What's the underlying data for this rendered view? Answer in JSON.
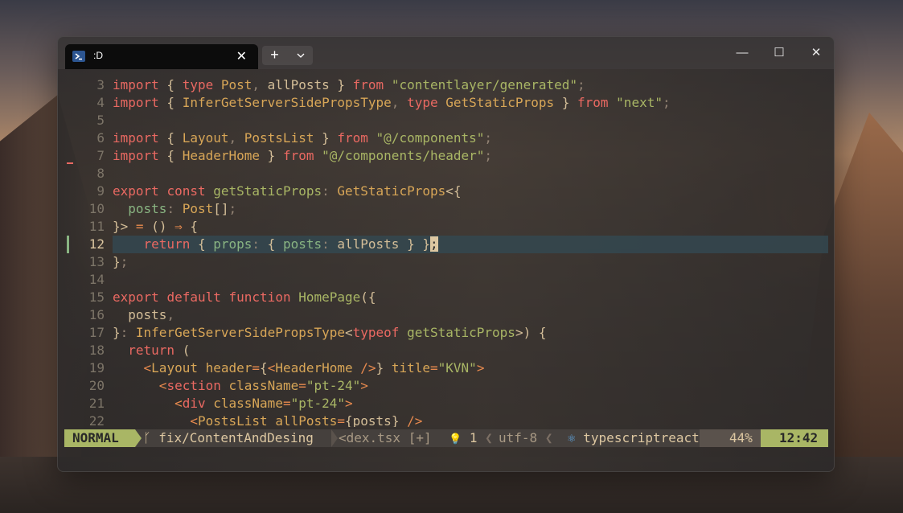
{
  "tab": {
    "title": ":D",
    "close": "✕"
  },
  "titlebar": {
    "new_tab": "+",
    "minimize": "—",
    "maximize": "☐",
    "close": "✕"
  },
  "editor": {
    "lines": [
      {
        "num": "3",
        "tokens": [
          [
            "kw",
            "import"
          ],
          [
            "plain",
            " { "
          ],
          [
            "kw",
            "type"
          ],
          [
            "plain",
            " "
          ],
          [
            "typ",
            "Post"
          ],
          [
            "pun",
            ", "
          ],
          [
            "plain",
            "allPosts } "
          ],
          [
            "kw",
            "from"
          ],
          [
            "plain",
            " "
          ],
          [
            "str",
            "\"contentlayer/generated\""
          ],
          [
            "pun",
            ";"
          ]
        ]
      },
      {
        "num": "4",
        "tokens": [
          [
            "kw",
            "import"
          ],
          [
            "plain",
            " { "
          ],
          [
            "typ",
            "InferGetServerSidePropsType"
          ],
          [
            "pun",
            ", "
          ],
          [
            "kw",
            "type"
          ],
          [
            "plain",
            " "
          ],
          [
            "typ",
            "GetStaticProps"
          ],
          [
            "plain",
            " } "
          ],
          [
            "kw",
            "from"
          ],
          [
            "plain",
            " "
          ],
          [
            "str",
            "\"next\""
          ],
          [
            "pun",
            ";"
          ]
        ]
      },
      {
        "num": "5",
        "tokens": []
      },
      {
        "num": "6",
        "tokens": [
          [
            "kw",
            "import"
          ],
          [
            "plain",
            " { "
          ],
          [
            "typ",
            "Layout"
          ],
          [
            "pun",
            ", "
          ],
          [
            "typ",
            "PostsList"
          ],
          [
            "plain",
            " } "
          ],
          [
            "kw",
            "from"
          ],
          [
            "plain",
            " "
          ],
          [
            "str",
            "\"@/components\""
          ],
          [
            "pun",
            ";"
          ]
        ]
      },
      {
        "num": "7",
        "tokens": [
          [
            "kw",
            "import"
          ],
          [
            "plain",
            " { "
          ],
          [
            "typ",
            "HeaderHome"
          ],
          [
            "plain",
            " } "
          ],
          [
            "kw",
            "from"
          ],
          [
            "plain",
            " "
          ],
          [
            "str",
            "\"@/components/header\""
          ],
          [
            "pun",
            ";"
          ]
        ]
      },
      {
        "num": "8",
        "tokens": []
      },
      {
        "num": "9",
        "tokens": [
          [
            "kw",
            "export"
          ],
          [
            "plain",
            " "
          ],
          [
            "kw",
            "const"
          ],
          [
            "plain",
            " "
          ],
          [
            "fn",
            "getStaticProps"
          ],
          [
            "pun",
            ": "
          ],
          [
            "typ",
            "GetStaticProps"
          ],
          [
            "plain",
            "<{"
          ]
        ]
      },
      {
        "num": "10",
        "tokens": [
          [
            "plain",
            "  "
          ],
          [
            "prop",
            "posts"
          ],
          [
            "pun",
            ": "
          ],
          [
            "typ",
            "Post"
          ],
          [
            "plain",
            "[]"
          ],
          [
            "pun",
            ";"
          ]
        ]
      },
      {
        "num": "11",
        "tokens": [
          [
            "plain",
            "}> "
          ],
          [
            "op",
            "="
          ],
          [
            "plain",
            " () "
          ],
          [
            "op",
            "⇒"
          ],
          [
            "plain",
            " {"
          ]
        ]
      },
      {
        "num": "12",
        "tokens": [
          [
            "plain",
            "    "
          ],
          [
            "kw",
            "return"
          ],
          [
            "plain",
            " { "
          ],
          [
            "prop",
            "props"
          ],
          [
            "pun",
            ": "
          ],
          [
            "plain",
            "{ "
          ],
          [
            "prop",
            "posts"
          ],
          [
            "pun",
            ": "
          ],
          [
            "plain",
            "allPosts } }"
          ],
          [
            "cursor",
            ";"
          ]
        ]
      },
      {
        "num": "13",
        "tokens": [
          [
            "plain",
            "}"
          ],
          [
            "pun",
            ";"
          ]
        ]
      },
      {
        "num": "14",
        "tokens": []
      },
      {
        "num": "15",
        "tokens": [
          [
            "kw",
            "export"
          ],
          [
            "plain",
            " "
          ],
          [
            "kw",
            "default"
          ],
          [
            "plain",
            " "
          ],
          [
            "kw",
            "function"
          ],
          [
            "plain",
            " "
          ],
          [
            "fn",
            "HomePage"
          ],
          [
            "plain",
            "({"
          ]
        ]
      },
      {
        "num": "16",
        "tokens": [
          [
            "plain",
            "  posts"
          ],
          [
            "pun",
            ","
          ]
        ]
      },
      {
        "num": "17",
        "tokens": [
          [
            "plain",
            "}"
          ],
          [
            "pun",
            ": "
          ],
          [
            "typ",
            "InferGetServerSidePropsType"
          ],
          [
            "plain",
            "<"
          ],
          [
            "kw",
            "typeof"
          ],
          [
            "plain",
            " "
          ],
          [
            "fn",
            "getStaticProps"
          ],
          [
            "plain",
            ">) {"
          ]
        ]
      },
      {
        "num": "18",
        "tokens": [
          [
            "plain",
            "  "
          ],
          [
            "kw",
            "return"
          ],
          [
            "plain",
            " ("
          ]
        ]
      },
      {
        "num": "19",
        "tokens": [
          [
            "plain",
            "    "
          ],
          [
            "tag",
            "<"
          ],
          [
            "typ",
            "Layout"
          ],
          [
            "plain",
            " "
          ],
          [
            "attr",
            "header"
          ],
          [
            "op",
            "="
          ],
          [
            "plain",
            "{"
          ],
          [
            "tag",
            "<"
          ],
          [
            "typ",
            "HeaderHome"
          ],
          [
            "plain",
            " "
          ],
          [
            "tag",
            "/>"
          ],
          [
            "plain",
            "} "
          ],
          [
            "attr",
            "title"
          ],
          [
            "op",
            "="
          ],
          [
            "str",
            "\"KVN\""
          ],
          [
            "tag",
            ">"
          ]
        ]
      },
      {
        "num": "20",
        "tokens": [
          [
            "plain",
            "      "
          ],
          [
            "tag",
            "<"
          ],
          [
            "kw",
            "section"
          ],
          [
            "plain",
            " "
          ],
          [
            "attr",
            "className"
          ],
          [
            "op",
            "="
          ],
          [
            "str",
            "\"pt-24\""
          ],
          [
            "tag",
            ">"
          ]
        ]
      },
      {
        "num": "21",
        "tokens": [
          [
            "plain",
            "        "
          ],
          [
            "tag",
            "<"
          ],
          [
            "kw",
            "div"
          ],
          [
            "plain",
            " "
          ],
          [
            "attr",
            "className"
          ],
          [
            "op",
            "="
          ],
          [
            "str",
            "\"pt-24\""
          ],
          [
            "tag",
            ">"
          ]
        ]
      },
      {
        "num": "22",
        "tokens": [
          [
            "plain",
            "          "
          ],
          [
            "tag",
            "<"
          ],
          [
            "typ",
            "PostsList"
          ],
          [
            "plain",
            " "
          ],
          [
            "attr",
            "allPosts"
          ],
          [
            "op",
            "="
          ],
          [
            "plain",
            "{posts} "
          ],
          [
            "tag",
            "/>"
          ]
        ]
      }
    ],
    "current_line": "12",
    "diff_markers": {
      "7": "removed",
      "12": "changed"
    }
  },
  "statusline": {
    "mode": "NORMAL",
    "branch_icon": "ᚴ",
    "branch": "fix/ContentAndDesing",
    "file": "<dex.tsx [+]",
    "diag_icon": "💡",
    "diag_count": "1",
    "encoding": "utf-8",
    "filetype_icon": "⚛",
    "filetype": "typescriptreact",
    "percent": "44%",
    "position": "12:42"
  },
  "colors": {
    "keyword": "#ea6962",
    "string": "#a9b665",
    "type": "#d8a657",
    "property": "#89b482",
    "operator": "#e78a4e",
    "mode_bg": "#a9b665",
    "current_line_bg": "#344850"
  }
}
